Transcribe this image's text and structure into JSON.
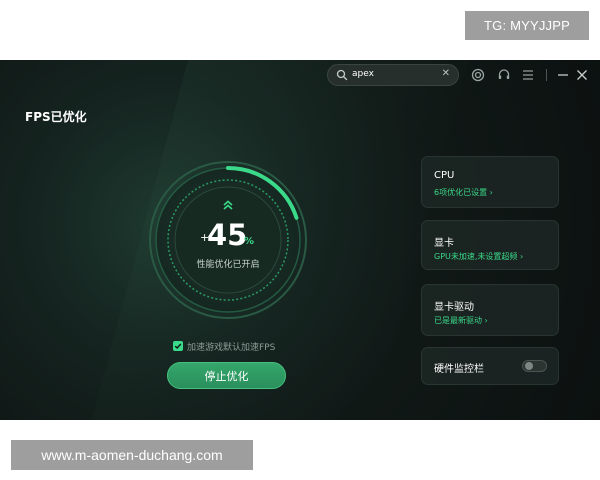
{
  "overlays": {
    "tg_badge": "TG: MYYJJPP",
    "website": "www.m-aomen-duchang.com"
  },
  "titlebar": {
    "search_value": "apex",
    "icons": [
      "search-icon",
      "clear-icon",
      "record-icon",
      "headset-icon",
      "menu-icon",
      "minimize-icon",
      "close-icon"
    ]
  },
  "page": {
    "title": "FPS已优化"
  },
  "gauge": {
    "percent_prefix": "+",
    "percent_value": "45",
    "percent_unit": "%",
    "progress_fraction": 0.2,
    "status": "性能优化已开启"
  },
  "options": {
    "checkbox_label": "加速游戏默认加速FPS",
    "checkbox_checked": true,
    "stop_button": "停止优化"
  },
  "cards": [
    {
      "title": "CPU",
      "subtitle": "6项优化已设置 ›"
    },
    {
      "title": "显卡",
      "subtitle": "GPU未加速,未设置超频 ›"
    },
    {
      "title": "显卡驱动",
      "subtitle": "已是最新驱动 ›"
    }
  ],
  "hardware_monitor": {
    "label": "硬件监控栏",
    "enabled": false
  },
  "colors": {
    "accent": "#3bd98a",
    "button": "#2f9a63",
    "background": "#0f1614"
  }
}
